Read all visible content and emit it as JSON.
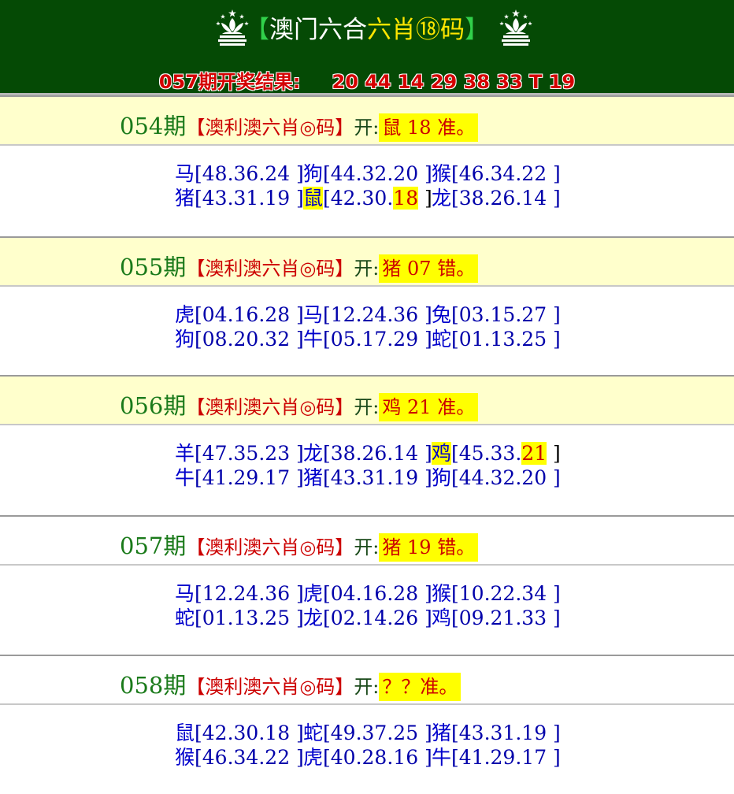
{
  "header": {
    "title_left_bracket": "【",
    "title_part1": "澳门六合",
    "title_part2": "六肖⑱码",
    "title_right_bracket": "】",
    "result_label": "057期开奖结果:",
    "result_numbers": "20 44 14 29 38 33 T 19"
  },
  "periods": [
    {
      "number": "054期",
      "label": "【澳利澳六肖◎码】",
      "open": "开:",
      "result": "鼠 18 准。",
      "style": "yellow",
      "rows": [
        [
          {
            "z": "马",
            "n": "[48.36.24 ]"
          },
          {
            "z": "狗",
            "n": "[44.32.20 ]"
          },
          {
            "z": "猴",
            "n": "[46.34.22 ]"
          }
        ],
        [
          {
            "z": "猪",
            "n": "[43.31.19 ]"
          },
          {
            "z": "鼠",
            "n": "[42.30.",
            "h": "18",
            "t": " ]",
            "hit": true
          },
          {
            "z": "龙",
            "n": "[38.26.14 ]"
          }
        ]
      ]
    },
    {
      "number": "055期",
      "label": "【澳利澳六肖◎码】",
      "open": "开:",
      "result": "猪 07 错。",
      "style": "yellow",
      "rows": [
        [
          {
            "z": "虎",
            "n": "[04.16.28 ]"
          },
          {
            "z": "马",
            "n": "[12.24.36 ]"
          },
          {
            "z": "兔",
            "n": "[03.15.27 ]"
          }
        ],
        [
          {
            "z": "狗",
            "n": "[08.20.32 ]"
          },
          {
            "z": "牛",
            "n": "[05.17.29 ]"
          },
          {
            "z": "蛇",
            "n": "[01.13.25 ]"
          }
        ]
      ]
    },
    {
      "number": "056期",
      "label": "【澳利澳六肖◎码】",
      "open": "开:",
      "result": "鸡 21 准。",
      "style": "yellow",
      "rows": [
        [
          {
            "z": "羊",
            "n": "[47.35.23 ]"
          },
          {
            "z": "龙",
            "n": "[38.26.14 ]"
          },
          {
            "z": "鸡",
            "n": "[45.33.",
            "h": "21",
            "t": " ]",
            "hit": true
          }
        ],
        [
          {
            "z": "牛",
            "n": "[41.29.17 ]"
          },
          {
            "z": "猪",
            "n": "[43.31.19 ]"
          },
          {
            "z": "狗",
            "n": "[44.32.20 ]"
          }
        ]
      ]
    },
    {
      "number": "057期",
      "label": "【澳利澳六肖◎码】",
      "open": "开:",
      "result": "猪 19 错。",
      "style": "white",
      "rows": [
        [
          {
            "z": "马",
            "n": "[12.24.36 ]"
          },
          {
            "z": "虎",
            "n": "[04.16.28 ]"
          },
          {
            "z": "猴",
            "n": "[10.22.34 ]"
          }
        ],
        [
          {
            "z": "蛇",
            "n": "[01.13.25 ]"
          },
          {
            "z": "龙",
            "n": "[02.14.26 ]"
          },
          {
            "z": "鸡",
            "n": "[09.21.33 ]"
          }
        ]
      ]
    },
    {
      "number": "058期",
      "label": "【澳利澳六肖◎码】",
      "open": "开:",
      "result": "？？准。",
      "style": "white",
      "rows": [
        [
          {
            "z": "鼠",
            "n": "[42.30.18 ]"
          },
          {
            "z": "蛇",
            "n": "[49.37.25 ]"
          },
          {
            "z": "猪",
            "n": "[43.31.19 ]"
          }
        ],
        [
          {
            "z": "猴",
            "n": "[46.34.22 ]"
          },
          {
            "z": "虎",
            "n": "[40.28.16 ]"
          },
          {
            "z": "牛",
            "n": "[41.29.17 ]"
          }
        ]
      ]
    }
  ],
  "colors": {
    "header_bg": "#054a05",
    "accent_red": "#cc0000",
    "highlight": "#ffff00",
    "zodiac_blue": "#0000cc"
  }
}
